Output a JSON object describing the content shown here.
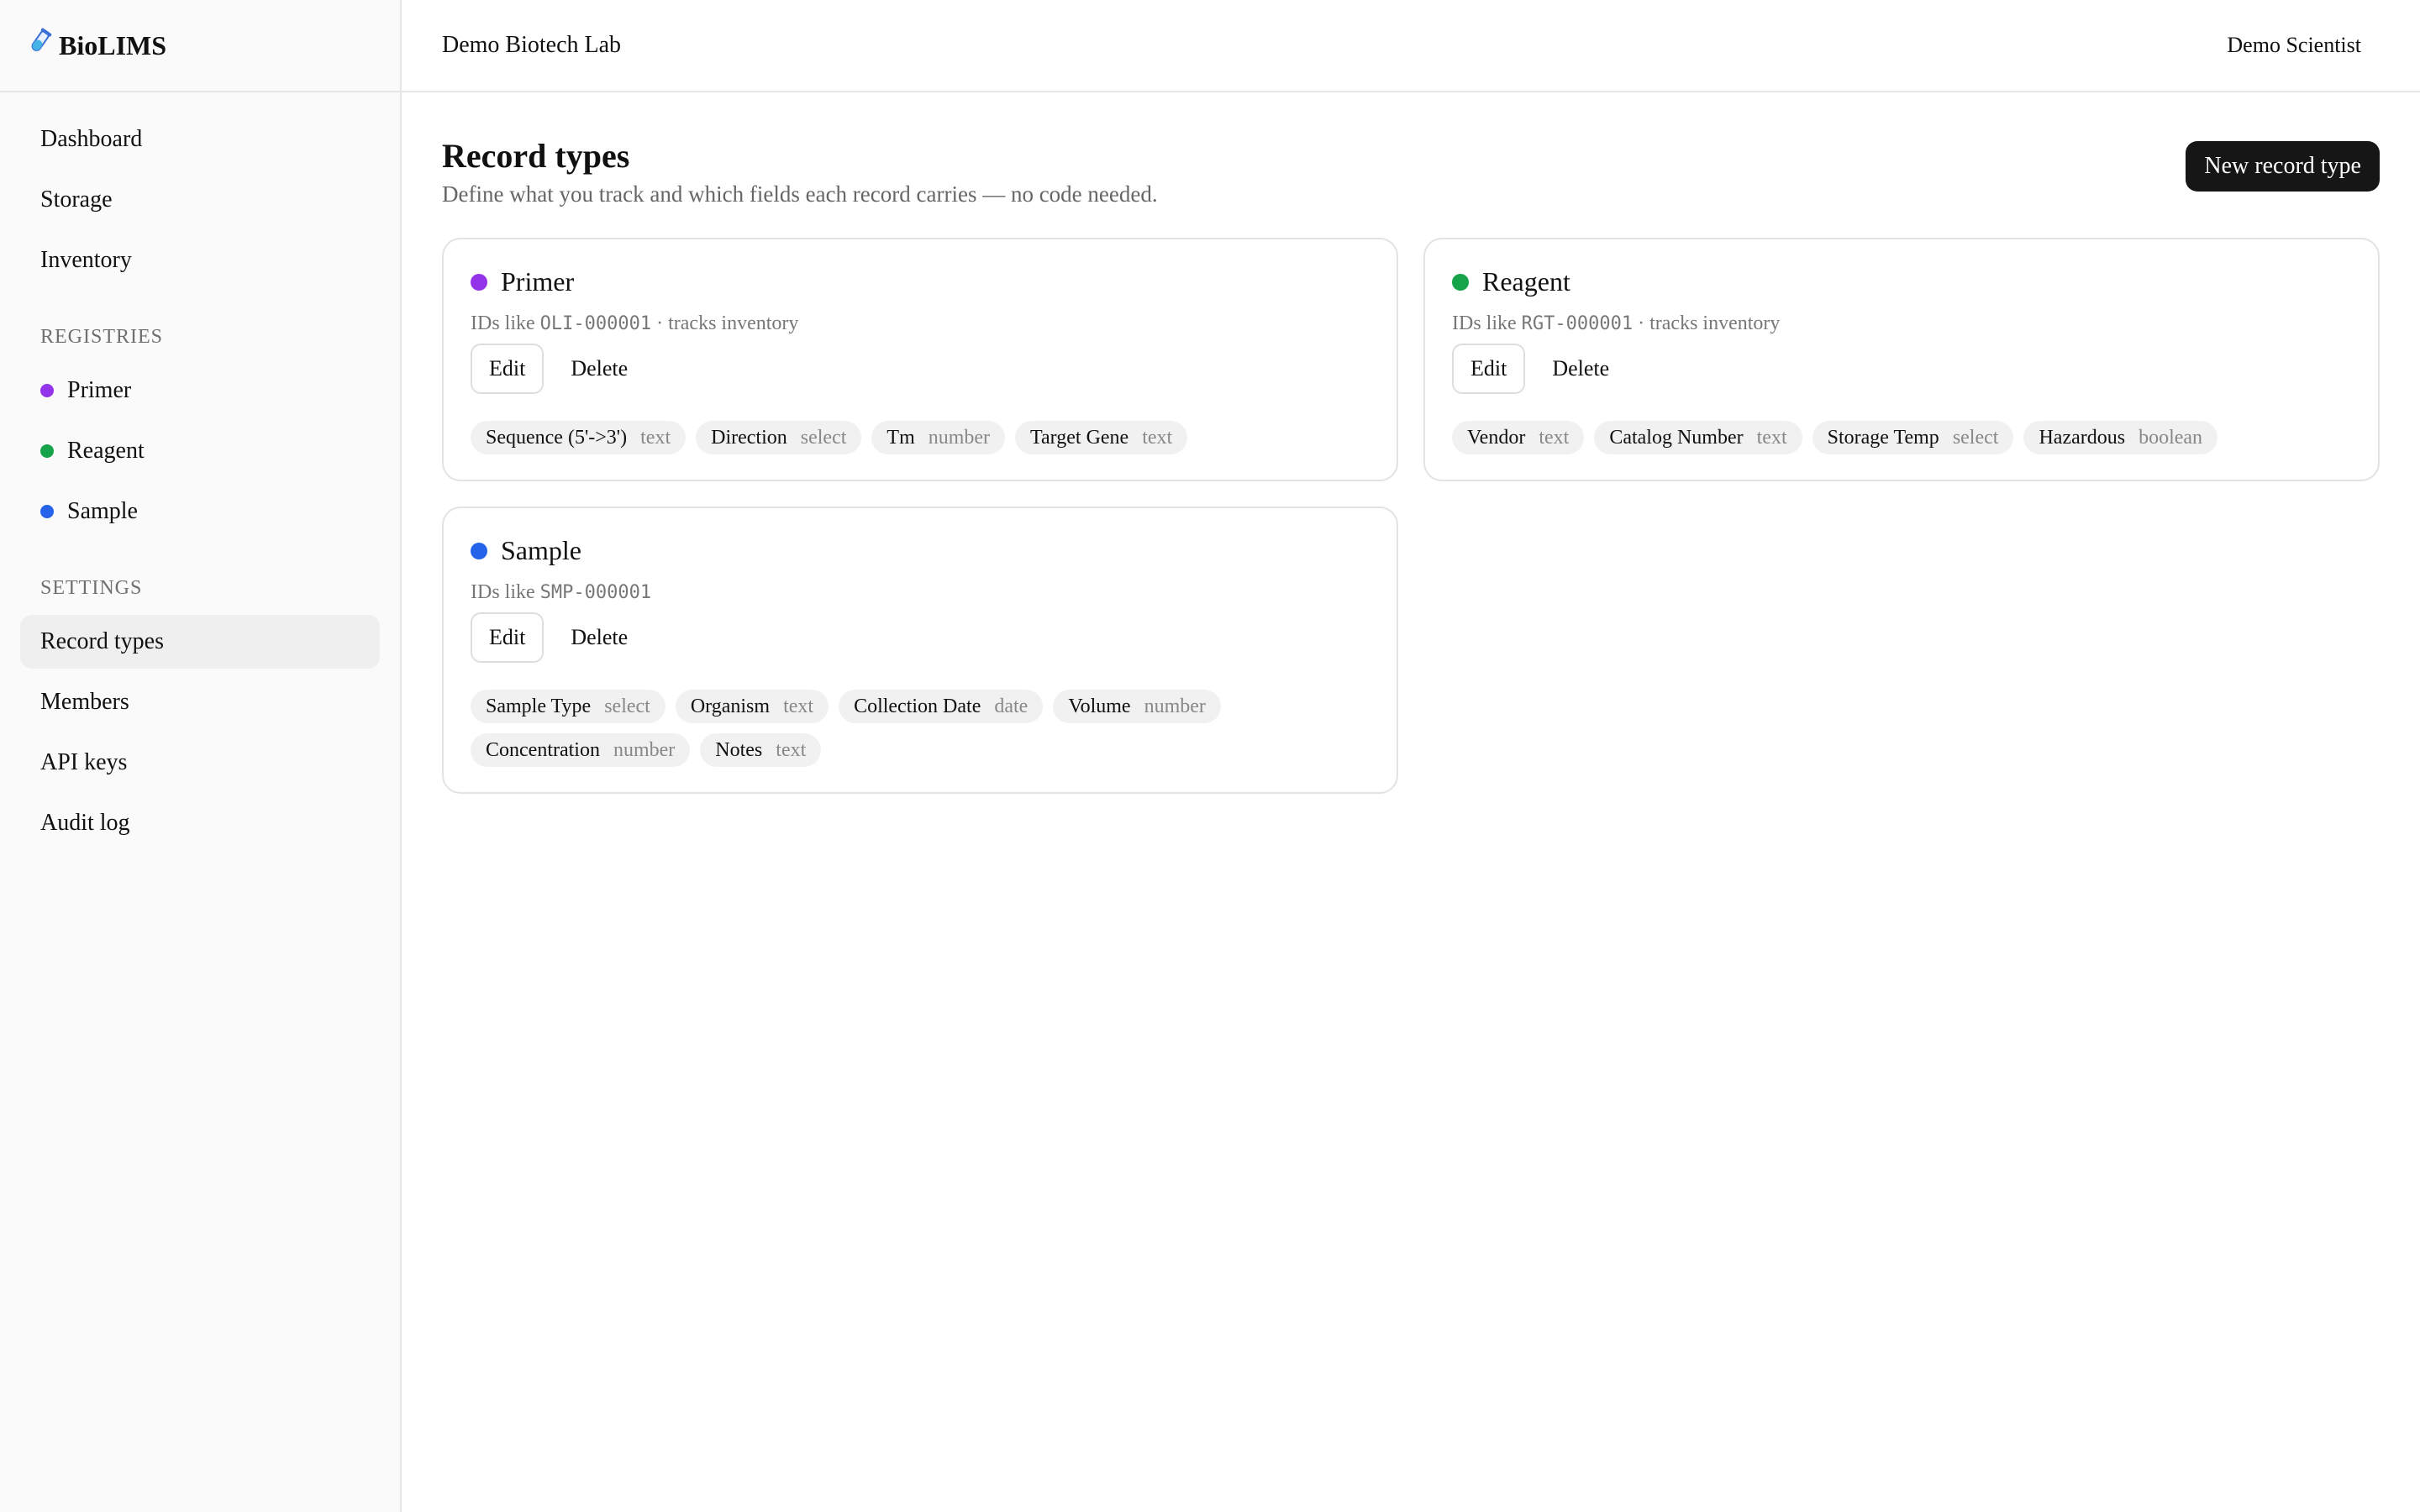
{
  "brand": {
    "icon": "test-tube-icon",
    "name": "BioLIMS"
  },
  "sidebar": {
    "main_items": [
      {
        "label": "Dashboard"
      },
      {
        "label": "Storage"
      },
      {
        "label": "Inventory"
      }
    ],
    "registries_heading": "REGISTRIES",
    "registries": [
      {
        "label": "Primer",
        "color": "#9333ea"
      },
      {
        "label": "Reagent",
        "color": "#16a34a"
      },
      {
        "label": "Sample",
        "color": "#2563eb"
      }
    ],
    "settings_heading": "SETTINGS",
    "settings_items": [
      {
        "label": "Record types",
        "active": true
      },
      {
        "label": "Members"
      },
      {
        "label": "API keys"
      },
      {
        "label": "Audit log"
      }
    ]
  },
  "topbar": {
    "org": "Demo Biotech Lab",
    "user": "Demo Scientist"
  },
  "page": {
    "title": "Record types",
    "subtitle": "Define what you track and which fields each record carries — no code needed.",
    "new_button": "New record type"
  },
  "cards": [
    {
      "name": "Primer",
      "color": "#9333ea",
      "ids_prefix": "IDs like",
      "id_example": "OLI-000001",
      "suffix": "· tracks inventory",
      "edit": "Edit",
      "delete": "Delete",
      "fields": [
        {
          "name": "Sequence (5'->3')",
          "type": "text"
        },
        {
          "name": "Direction",
          "type": "select"
        },
        {
          "name": "Tm",
          "type": "number"
        },
        {
          "name": "Target Gene",
          "type": "text"
        }
      ]
    },
    {
      "name": "Reagent",
      "color": "#16a34a",
      "ids_prefix": "IDs like",
      "id_example": "RGT-000001",
      "suffix": "· tracks inventory",
      "edit": "Edit",
      "delete": "Delete",
      "fields": [
        {
          "name": "Vendor",
          "type": "text"
        },
        {
          "name": "Catalog Number",
          "type": "text"
        },
        {
          "name": "Storage Temp",
          "type": "select"
        },
        {
          "name": "Hazardous",
          "type": "boolean"
        }
      ]
    },
    {
      "name": "Sample",
      "color": "#2563eb",
      "ids_prefix": "IDs like",
      "id_example": "SMP-000001",
      "suffix": "",
      "edit": "Edit",
      "delete": "Delete",
      "fields": [
        {
          "name": "Sample Type",
          "type": "select"
        },
        {
          "name": "Organism",
          "type": "text"
        },
        {
          "name": "Collection Date",
          "type": "date"
        },
        {
          "name": "Volume",
          "type": "number"
        },
        {
          "name": "Concentration",
          "type": "number"
        },
        {
          "name": "Notes",
          "type": "text"
        }
      ]
    }
  ]
}
